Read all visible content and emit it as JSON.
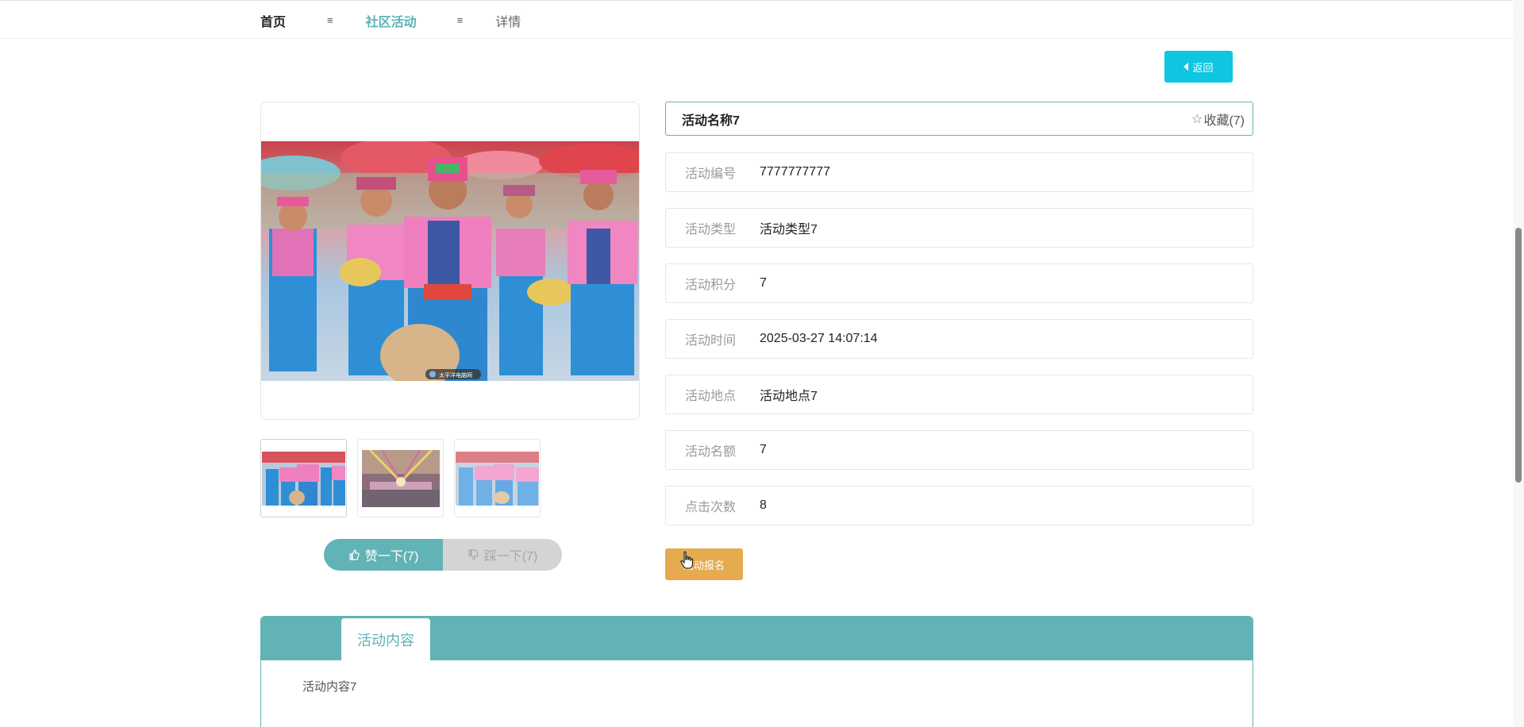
{
  "breadcrumb": {
    "home": "首页",
    "sep": "≡",
    "category": "社区活动",
    "current": "详情"
  },
  "back_button": {
    "label": "返回",
    "icon": "caret-left-icon"
  },
  "title_box": {
    "title": "活动名称7",
    "favorite_label": "收藏(7)",
    "favorite_icon": "star-outline-icon"
  },
  "fields": [
    {
      "label": "活动编号",
      "value": "7777777777"
    },
    {
      "label": "活动类型",
      "value": "活动类型7"
    },
    {
      "label": "活动积分",
      "value": "7"
    },
    {
      "label": "活动时间",
      "value": "2025-03-27 14:07:14"
    },
    {
      "label": "活动地点",
      "value": "活动地点7"
    },
    {
      "label": "活动名额",
      "value": "7"
    },
    {
      "label": "点击次数",
      "value": "8"
    }
  ],
  "signup_button": {
    "label": "活动报名"
  },
  "photo": {
    "watermark": "太平洋电脑网"
  },
  "votes": {
    "like_label": "赞一下(7)",
    "dislike_label": "踩一下(7)"
  },
  "content": {
    "tab_label": "活动内容",
    "text": "活动内容7"
  },
  "colors": {
    "accent": "#62b3b5",
    "back_button": "#0fc6e0",
    "signup_button": "#e5ab4e"
  }
}
